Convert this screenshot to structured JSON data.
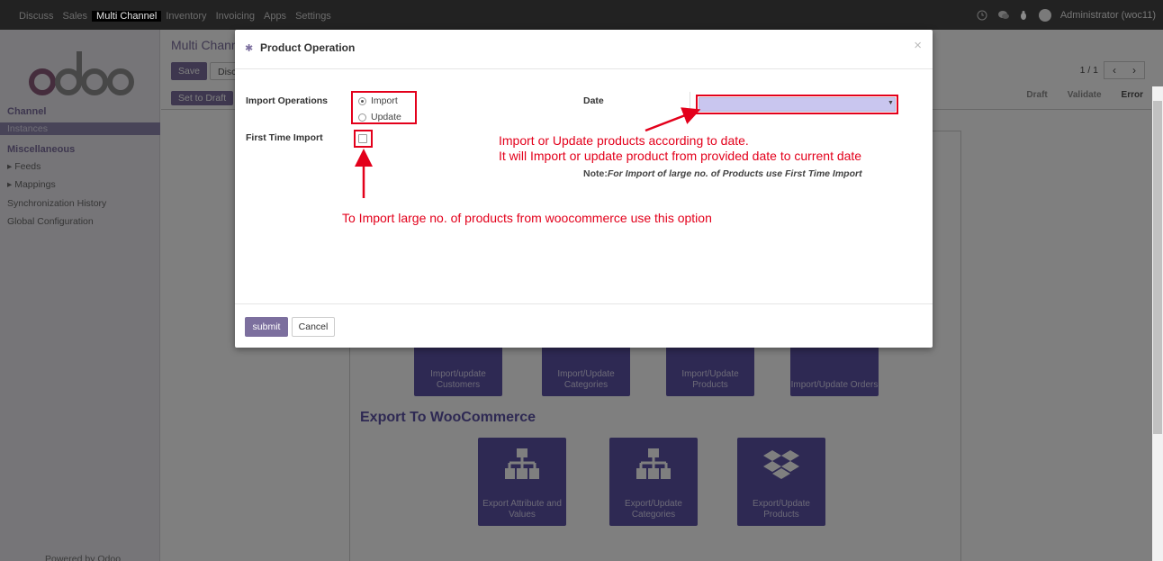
{
  "topbar": {
    "menu": [
      "Discuss",
      "Sales",
      "Multi Channel",
      "Inventory",
      "Invoicing",
      "Apps",
      "Settings"
    ],
    "active_menu": "Multi Channel",
    "user": "Administrator (woc11)"
  },
  "sidebar": {
    "logo": "odoo",
    "section_channel": "Channel",
    "instances": "Instances",
    "section_misc": "Miscellaneous",
    "items": [
      "Feeds",
      "Mappings",
      "Synchronization History",
      "Global Configuration"
    ],
    "powered": "Powered by Odoo"
  },
  "form": {
    "title": "Multi Chann",
    "save": "Save",
    "discard": "Disc",
    "set_to_draft": "Set to Draft",
    "pager": "1 / 1",
    "stages": [
      "Draft",
      "Validate",
      "Error"
    ],
    "import_tiles": [
      "Import/update Customers",
      "Import/Update Categories",
      "Import/Update Products",
      "Import/Update Orders"
    ],
    "export_title": "Export To WooCommerce",
    "export_tiles": [
      "Export Attribute and Values",
      "Export/Update Categories",
      "Export/Update Products"
    ]
  },
  "modal": {
    "title": "Product Operation",
    "import_ops_label": "Import Operations",
    "radio_import": "Import",
    "radio_update": "Update",
    "first_time_label": "First Time Import",
    "date_label": "Date",
    "note_prefix": "Note:",
    "note_text": "For Import of large no. of Products use First Time Import",
    "submit": "submit",
    "cancel": "Cancel"
  },
  "annotations": {
    "date_line1": "Import or Update products according to date.",
    "date_line2": "It will Import or update product from  provided date to current date",
    "first_time": "To Import large no. of products from woocommerce use this option"
  },
  "colors": {
    "accent": "#7c6f9e",
    "annotation_red": "#e3001b",
    "tile": "#5d52a6"
  }
}
